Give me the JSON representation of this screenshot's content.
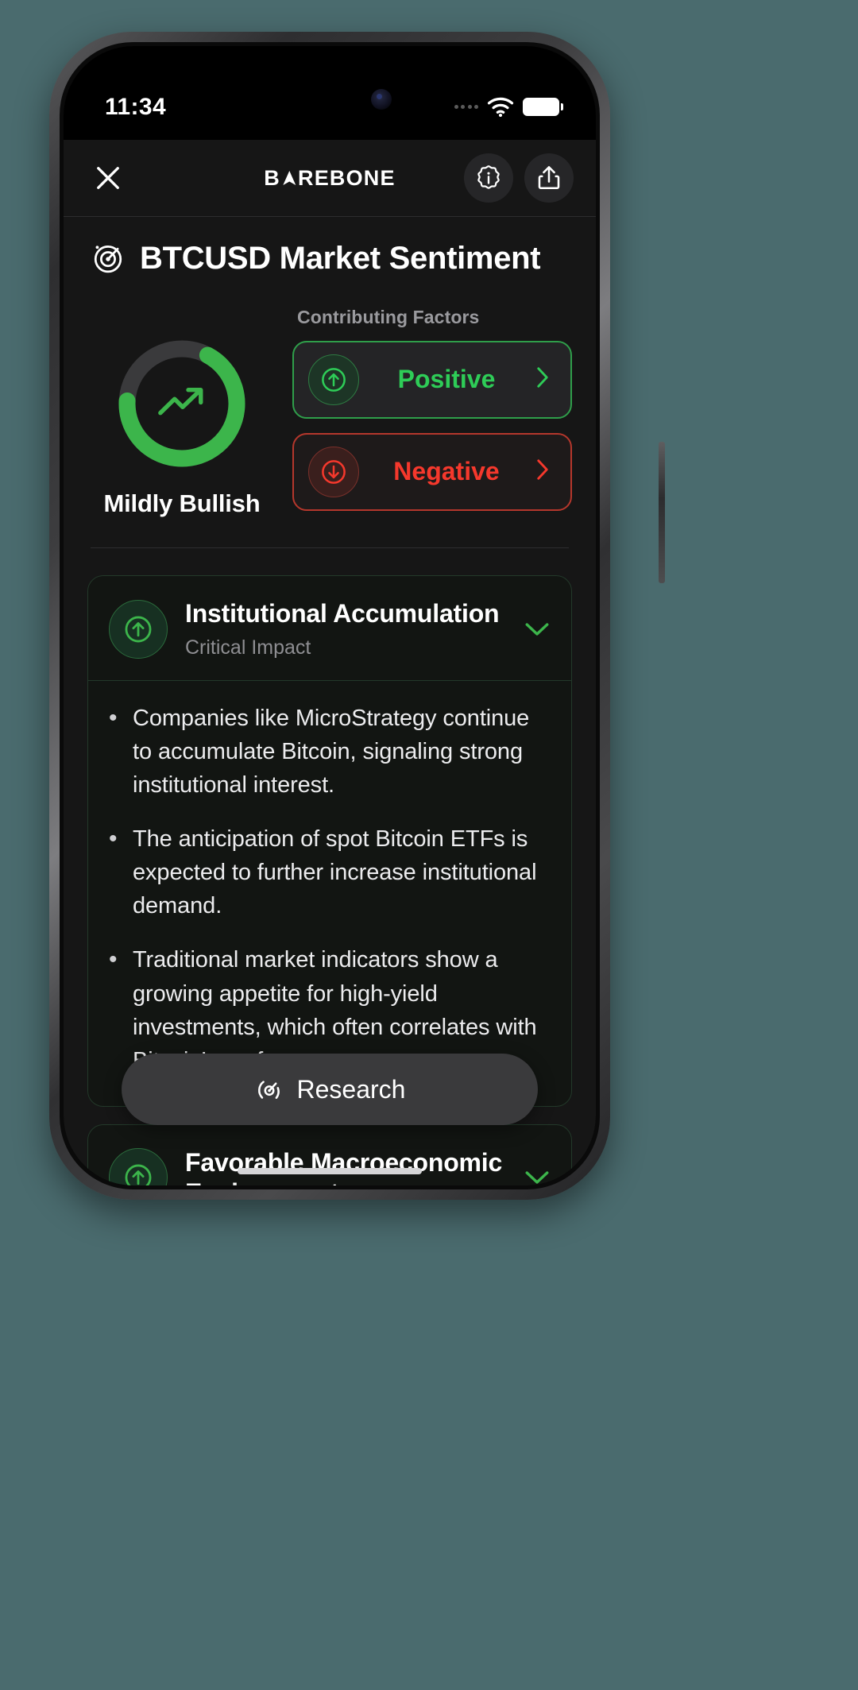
{
  "status_bar": {
    "time": "11:34",
    "wifi_icon": "wifi-icon",
    "battery_icon": "battery-icon"
  },
  "appbar": {
    "close_icon": "close-icon",
    "brand_part1": "B",
    "brand_mark": "chevron-up-mark",
    "brand_part2": "REBONE",
    "info_icon": "info-badge-icon",
    "share_icon": "share-icon"
  },
  "page": {
    "title": "BTCUSD Market Sentiment",
    "title_icon": "radar-target-icon"
  },
  "sentiment": {
    "gauge": {
      "label": "Mildly Bullish",
      "percent": 68,
      "track_color": "#3a3a3c",
      "value_color": "#3cb54b",
      "icon": "trend-up-arrow-icon"
    },
    "factors_heading": "Contributing Factors",
    "factors": [
      {
        "label": "Positive",
        "icon": "arrow-up-circle-icon",
        "chevron": "chevron-right-icon",
        "color": "#2ecc57"
      },
      {
        "label": "Negative",
        "icon": "arrow-down-circle-icon",
        "chevron": "chevron-right-icon",
        "color": "#f5382c"
      }
    ]
  },
  "cards": [
    {
      "title": "Institutional Accumulation",
      "subtitle": "Critical Impact",
      "icon": "arrow-up-circle-icon",
      "chevron": "chevron-down-icon",
      "expanded": true,
      "bullets": [
        "Companies like MicroStrategy continue to accumulate Bitcoin, signaling strong institutional interest.",
        "The anticipation of spot Bitcoin ETFs is expected to further increase institutional demand.",
        "Traditional market indicators show a growing appetite for high-yield investments, which often correlates with Bitcoin’s performance."
      ]
    },
    {
      "title": "Favorable Macroeconomic Environment",
      "subtitle": "",
      "icon": "arrow-up-circle-icon",
      "chevron": "chevron-down-icon",
      "expanded": false,
      "bullets": []
    }
  ],
  "research_button": {
    "label": "Research",
    "icon": "research-scan-icon"
  },
  "colors": {
    "accent_green": "#3cb54b",
    "accent_red": "#f5382c",
    "app_background": "#161616",
    "card_background": "#121512"
  }
}
